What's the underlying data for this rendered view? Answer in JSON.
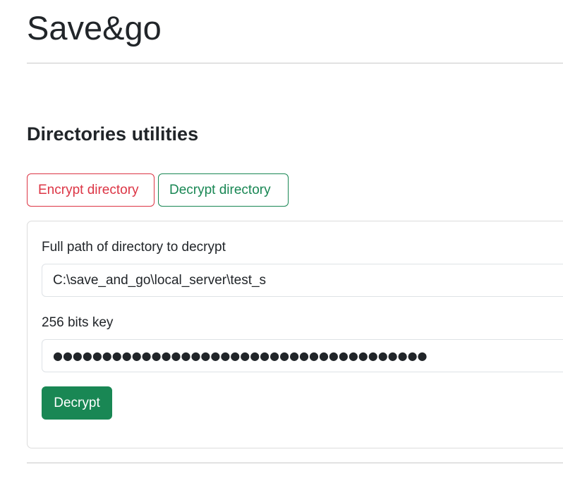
{
  "app": {
    "title": "Save&go"
  },
  "section": {
    "title": "Directories utilities"
  },
  "tabs": [
    {
      "label": "Encrypt directory",
      "color": "#dc3545"
    },
    {
      "label": "Decrypt directory",
      "color": "#198754"
    }
  ],
  "form": {
    "path_label": "Full path of directory to decrypt",
    "path_value": "C:\\save_and_go\\local_server\\test_s",
    "key_label": "256 bits key",
    "key_value": "●●●●●●●●●●●●●●●●●●●●●●●●●●●●●●●●●●●●●●",
    "submit_label": "Decrypt"
  },
  "colors": {
    "success": "#198754",
    "danger": "#dc3545"
  }
}
